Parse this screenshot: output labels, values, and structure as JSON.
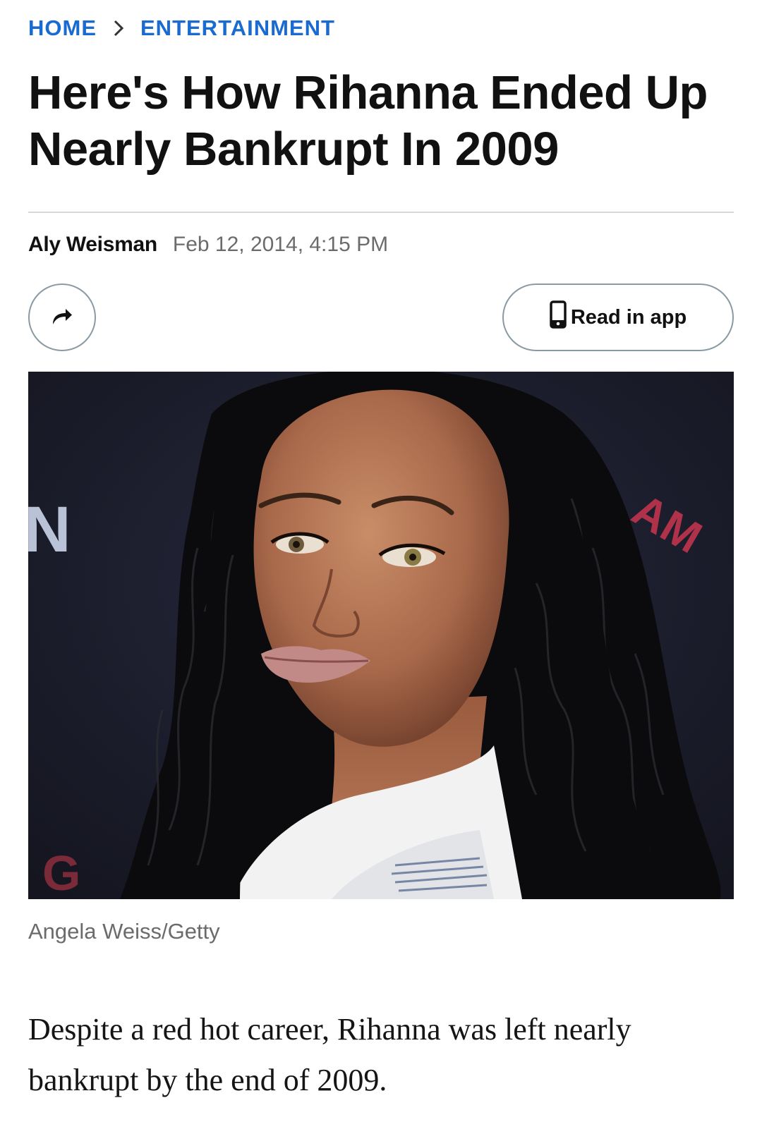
{
  "breadcrumb": {
    "home": "HOME",
    "section": "ENTERTAINMENT"
  },
  "article": {
    "headline": "Here's How Rihanna Ended Up Nearly Bankrupt In 2009",
    "author": "Aly Weisman",
    "date": "Feb 12, 2014, 4:15 PM",
    "photo_credit": "Angela Weiss/Getty",
    "lede": "Despite a red hot career, Rihanna was left nearly bankrupt by the end of 2009."
  },
  "actions": {
    "share_icon": "share-arrow-icon",
    "read_in_app_label": "Read in app",
    "read_in_app_icon": "phone-icon"
  },
  "photo": {
    "backdrop_text_left": "N",
    "backdrop_text_right": "AM",
    "backdrop_text_bottom": "G"
  },
  "colors": {
    "link_blue": "#1a6bd1",
    "muted_text": "#6b6b6b",
    "border": "#8a9aa4"
  }
}
